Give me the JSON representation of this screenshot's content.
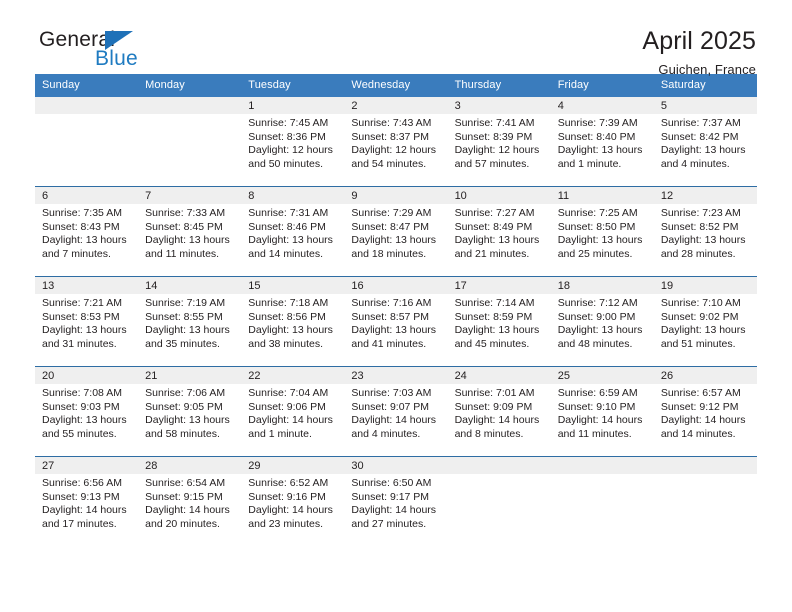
{
  "brand": {
    "name_part1": "General",
    "name_part2": "Blue",
    "triangle_color": "#1f71b8",
    "blue_color": "#1f7bc1"
  },
  "header": {
    "title": "April 2025",
    "subtitle": "Guichen, France"
  },
  "theme": {
    "header_bar": "#3a7cbd",
    "row_divider": "#2e6da4",
    "daynum_band": "#efefef",
    "text": "#231f20"
  },
  "weekday_headers": [
    "Sunday",
    "Monday",
    "Tuesday",
    "Wednesday",
    "Thursday",
    "Friday",
    "Saturday"
  ],
  "weeks": [
    [
      {
        "day": "",
        "sunrise": "",
        "sunset": "",
        "daylight_line1": "",
        "daylight_line2": ""
      },
      {
        "day": "",
        "sunrise": "",
        "sunset": "",
        "daylight_line1": "",
        "daylight_line2": ""
      },
      {
        "day": "1",
        "sunrise": "Sunrise: 7:45 AM",
        "sunset": "Sunset: 8:36 PM",
        "daylight_line1": "Daylight: 12 hours",
        "daylight_line2": "and 50 minutes."
      },
      {
        "day": "2",
        "sunrise": "Sunrise: 7:43 AM",
        "sunset": "Sunset: 8:37 PM",
        "daylight_line1": "Daylight: 12 hours",
        "daylight_line2": "and 54 minutes."
      },
      {
        "day": "3",
        "sunrise": "Sunrise: 7:41 AM",
        "sunset": "Sunset: 8:39 PM",
        "daylight_line1": "Daylight: 12 hours",
        "daylight_line2": "and 57 minutes."
      },
      {
        "day": "4",
        "sunrise": "Sunrise: 7:39 AM",
        "sunset": "Sunset: 8:40 PM",
        "daylight_line1": "Daylight: 13 hours",
        "daylight_line2": "and 1 minute."
      },
      {
        "day": "5",
        "sunrise": "Sunrise: 7:37 AM",
        "sunset": "Sunset: 8:42 PM",
        "daylight_line1": "Daylight: 13 hours",
        "daylight_line2": "and 4 minutes."
      }
    ],
    [
      {
        "day": "6",
        "sunrise": "Sunrise: 7:35 AM",
        "sunset": "Sunset: 8:43 PM",
        "daylight_line1": "Daylight: 13 hours",
        "daylight_line2": "and 7 minutes."
      },
      {
        "day": "7",
        "sunrise": "Sunrise: 7:33 AM",
        "sunset": "Sunset: 8:45 PM",
        "daylight_line1": "Daylight: 13 hours",
        "daylight_line2": "and 11 minutes."
      },
      {
        "day": "8",
        "sunrise": "Sunrise: 7:31 AM",
        "sunset": "Sunset: 8:46 PM",
        "daylight_line1": "Daylight: 13 hours",
        "daylight_line2": "and 14 minutes."
      },
      {
        "day": "9",
        "sunrise": "Sunrise: 7:29 AM",
        "sunset": "Sunset: 8:47 PM",
        "daylight_line1": "Daylight: 13 hours",
        "daylight_line2": "and 18 minutes."
      },
      {
        "day": "10",
        "sunrise": "Sunrise: 7:27 AM",
        "sunset": "Sunset: 8:49 PM",
        "daylight_line1": "Daylight: 13 hours",
        "daylight_line2": "and 21 minutes."
      },
      {
        "day": "11",
        "sunrise": "Sunrise: 7:25 AM",
        "sunset": "Sunset: 8:50 PM",
        "daylight_line1": "Daylight: 13 hours",
        "daylight_line2": "and 25 minutes."
      },
      {
        "day": "12",
        "sunrise": "Sunrise: 7:23 AM",
        "sunset": "Sunset: 8:52 PM",
        "daylight_line1": "Daylight: 13 hours",
        "daylight_line2": "and 28 minutes."
      }
    ],
    [
      {
        "day": "13",
        "sunrise": "Sunrise: 7:21 AM",
        "sunset": "Sunset: 8:53 PM",
        "daylight_line1": "Daylight: 13 hours",
        "daylight_line2": "and 31 minutes."
      },
      {
        "day": "14",
        "sunrise": "Sunrise: 7:19 AM",
        "sunset": "Sunset: 8:55 PM",
        "daylight_line1": "Daylight: 13 hours",
        "daylight_line2": "and 35 minutes."
      },
      {
        "day": "15",
        "sunrise": "Sunrise: 7:18 AM",
        "sunset": "Sunset: 8:56 PM",
        "daylight_line1": "Daylight: 13 hours",
        "daylight_line2": "and 38 minutes."
      },
      {
        "day": "16",
        "sunrise": "Sunrise: 7:16 AM",
        "sunset": "Sunset: 8:57 PM",
        "daylight_line1": "Daylight: 13 hours",
        "daylight_line2": "and 41 minutes."
      },
      {
        "day": "17",
        "sunrise": "Sunrise: 7:14 AM",
        "sunset": "Sunset: 8:59 PM",
        "daylight_line1": "Daylight: 13 hours",
        "daylight_line2": "and 45 minutes."
      },
      {
        "day": "18",
        "sunrise": "Sunrise: 7:12 AM",
        "sunset": "Sunset: 9:00 PM",
        "daylight_line1": "Daylight: 13 hours",
        "daylight_line2": "and 48 minutes."
      },
      {
        "day": "19",
        "sunrise": "Sunrise: 7:10 AM",
        "sunset": "Sunset: 9:02 PM",
        "daylight_line1": "Daylight: 13 hours",
        "daylight_line2": "and 51 minutes."
      }
    ],
    [
      {
        "day": "20",
        "sunrise": "Sunrise: 7:08 AM",
        "sunset": "Sunset: 9:03 PM",
        "daylight_line1": "Daylight: 13 hours",
        "daylight_line2": "and 55 minutes."
      },
      {
        "day": "21",
        "sunrise": "Sunrise: 7:06 AM",
        "sunset": "Sunset: 9:05 PM",
        "daylight_line1": "Daylight: 13 hours",
        "daylight_line2": "and 58 minutes."
      },
      {
        "day": "22",
        "sunrise": "Sunrise: 7:04 AM",
        "sunset": "Sunset: 9:06 PM",
        "daylight_line1": "Daylight: 14 hours",
        "daylight_line2": "and 1 minute."
      },
      {
        "day": "23",
        "sunrise": "Sunrise: 7:03 AM",
        "sunset": "Sunset: 9:07 PM",
        "daylight_line1": "Daylight: 14 hours",
        "daylight_line2": "and 4 minutes."
      },
      {
        "day": "24",
        "sunrise": "Sunrise: 7:01 AM",
        "sunset": "Sunset: 9:09 PM",
        "daylight_line1": "Daylight: 14 hours",
        "daylight_line2": "and 8 minutes."
      },
      {
        "day": "25",
        "sunrise": "Sunrise: 6:59 AM",
        "sunset": "Sunset: 9:10 PM",
        "daylight_line1": "Daylight: 14 hours",
        "daylight_line2": "and 11 minutes."
      },
      {
        "day": "26",
        "sunrise": "Sunrise: 6:57 AM",
        "sunset": "Sunset: 9:12 PM",
        "daylight_line1": "Daylight: 14 hours",
        "daylight_line2": "and 14 minutes."
      }
    ],
    [
      {
        "day": "27",
        "sunrise": "Sunrise: 6:56 AM",
        "sunset": "Sunset: 9:13 PM",
        "daylight_line1": "Daylight: 14 hours",
        "daylight_line2": "and 17 minutes."
      },
      {
        "day": "28",
        "sunrise": "Sunrise: 6:54 AM",
        "sunset": "Sunset: 9:15 PM",
        "daylight_line1": "Daylight: 14 hours",
        "daylight_line2": "and 20 minutes."
      },
      {
        "day": "29",
        "sunrise": "Sunrise: 6:52 AM",
        "sunset": "Sunset: 9:16 PM",
        "daylight_line1": "Daylight: 14 hours",
        "daylight_line2": "and 23 minutes."
      },
      {
        "day": "30",
        "sunrise": "Sunrise: 6:50 AM",
        "sunset": "Sunset: 9:17 PM",
        "daylight_line1": "Daylight: 14 hours",
        "daylight_line2": "and 27 minutes."
      },
      {
        "day": "",
        "sunrise": "",
        "sunset": "",
        "daylight_line1": "",
        "daylight_line2": ""
      },
      {
        "day": "",
        "sunrise": "",
        "sunset": "",
        "daylight_line1": "",
        "daylight_line2": ""
      },
      {
        "day": "",
        "sunrise": "",
        "sunset": "",
        "daylight_line1": "",
        "daylight_line2": ""
      }
    ]
  ]
}
